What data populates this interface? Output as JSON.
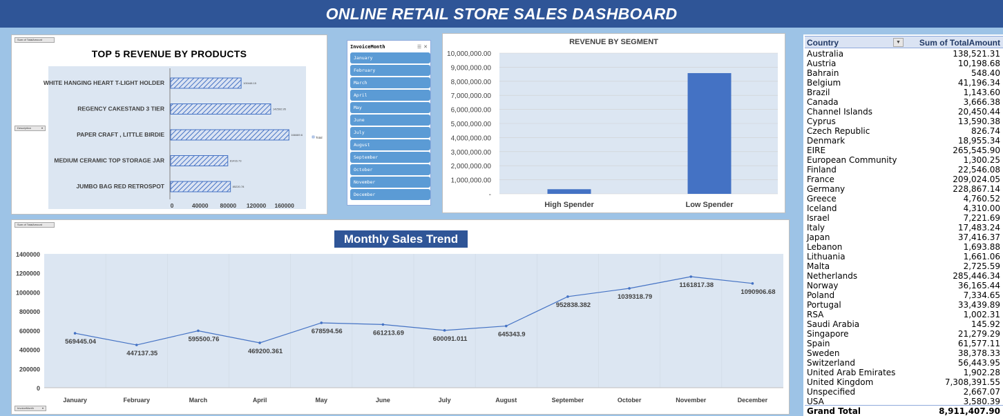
{
  "dashboard_title": "ONLINE RETAIL STORE SALES DASHBOARD",
  "pivot_buttons": {
    "sum_total_amount": "Sum of TotalAmount",
    "description": "Description",
    "invoice_month": "InvoiceMonth"
  },
  "slicer": {
    "title": "InvoiceMonth",
    "items": [
      "January",
      "February",
      "March",
      "April",
      "May",
      "June",
      "July",
      "August",
      "September",
      "October",
      "November",
      "December"
    ]
  },
  "pivot_table": {
    "col_country": "Country",
    "col_amount": "Sum of TotalAmount",
    "rows": [
      {
        "country": "Australia",
        "amount": "138,521.31"
      },
      {
        "country": "Austria",
        "amount": "10,198.68"
      },
      {
        "country": "Bahrain",
        "amount": "548.40"
      },
      {
        "country": "Belgium",
        "amount": "41,196.34"
      },
      {
        "country": "Brazil",
        "amount": "1,143.60"
      },
      {
        "country": "Canada",
        "amount": "3,666.38"
      },
      {
        "country": "Channel Islands",
        "amount": "20,450.44"
      },
      {
        "country": "Cyprus",
        "amount": "13,590.38"
      },
      {
        "country": "Czech Republic",
        "amount": "826.74"
      },
      {
        "country": "Denmark",
        "amount": "18,955.34"
      },
      {
        "country": "EIRE",
        "amount": "265,545.90"
      },
      {
        "country": "European Community",
        "amount": "1,300.25"
      },
      {
        "country": "Finland",
        "amount": "22,546.08"
      },
      {
        "country": "France",
        "amount": "209,024.05"
      },
      {
        "country": "Germany",
        "amount": "228,867.14"
      },
      {
        "country": "Greece",
        "amount": "4,760.52"
      },
      {
        "country": "Iceland",
        "amount": "4,310.00"
      },
      {
        "country": "Israel",
        "amount": "7,221.69"
      },
      {
        "country": "Italy",
        "amount": "17,483.24"
      },
      {
        "country": "Japan",
        "amount": "37,416.37"
      },
      {
        "country": "Lebanon",
        "amount": "1,693.88"
      },
      {
        "country": "Lithuania",
        "amount": "1,661.06"
      },
      {
        "country": "Malta",
        "amount": "2,725.59"
      },
      {
        "country": "Netherlands",
        "amount": "285,446.34"
      },
      {
        "country": "Norway",
        "amount": "36,165.44"
      },
      {
        "country": "Poland",
        "amount": "7,334.65"
      },
      {
        "country": "Portugal",
        "amount": "33,439.89"
      },
      {
        "country": "RSA",
        "amount": "1,002.31"
      },
      {
        "country": "Saudi Arabia",
        "amount": "145.92"
      },
      {
        "country": "Singapore",
        "amount": "21,279.29"
      },
      {
        "country": "Spain",
        "amount": "61,577.11"
      },
      {
        "country": "Sweden",
        "amount": "38,378.33"
      },
      {
        "country": "Switzerland",
        "amount": "56,443.95"
      },
      {
        "country": "United Arab Emirates",
        "amount": "1,902.28"
      },
      {
        "country": "United Kingdom",
        "amount": "7,308,391.55"
      },
      {
        "country": "Unspecified",
        "amount": "2,667.07"
      },
      {
        "country": "USA",
        "amount": "3,580.39"
      }
    ],
    "grand_total_label": "Grand Total",
    "grand_total_value": "8,911,407.90"
  },
  "chart_data": [
    {
      "type": "bar",
      "orientation": "horizontal",
      "title": "TOP 5 REVENUE BY PRODUCTS",
      "categories": [
        "WHITE HANGING HEART T-LIGHT HOLDER",
        "REGENCY CAKESTAND 3 TIER",
        "PAPER CRAFT , LITTLE BIRDIE",
        "MEDIUM CERAMIC TOP STORAGE JAR",
        "JUMBO BAG RED RETROSPOT"
      ],
      "series": [
        {
          "name": "Total",
          "values": [
            100448.15,
            142592.95,
            168469.6,
            81416.73,
            85220.78
          ]
        }
      ],
      "value_labels": [
        "100448.15",
        "142592.95",
        "168469.6",
        "81416.73",
        "85220.78"
      ],
      "xticks": [
        "0",
        "40000",
        "80000",
        "120000",
        "160000"
      ],
      "xlim": [
        0,
        180000
      ],
      "legend": "right",
      "bar_color": "#4472c4"
    },
    {
      "type": "bar",
      "title": "REVENUE BY SEGMENT",
      "categories": [
        "High Spender",
        "Low Spender"
      ],
      "values": [
        330000,
        8580000
      ],
      "yticks": [
        "10,000,000.00",
        "9,000,000.00",
        "8,000,000.00",
        "7,000,000.00",
        "6,000,000.00",
        "5,000,000.00",
        "4,000,000.00",
        "3,000,000.00",
        "2,000,000.00",
        "1,000,000.00",
        "-"
      ],
      "ylim": [
        0,
        10000000
      ],
      "bar_color": "#4472c4"
    },
    {
      "type": "line",
      "title": "Monthly Sales Trend",
      "categories": [
        "January",
        "February",
        "March",
        "April",
        "May",
        "June",
        "July",
        "August",
        "September",
        "October",
        "November",
        "December"
      ],
      "values": [
        569445.04,
        447137.35,
        595500.76,
        469200.361,
        678594.56,
        661213.69,
        600091.011,
        645343.9,
        952838.382,
        1039318.79,
        1161817.38,
        1090906.68
      ],
      "value_labels": [
        "569445.04",
        "447137.35",
        "595500.76",
        "469200.361",
        "678594.56",
        "661213.69",
        "600091.011",
        "645343.9",
        "952838.382",
        "1039318.79",
        "1161817.38",
        "1090906.68"
      ],
      "yticks": [
        "1400000",
        "1200000",
        "1000000",
        "800000",
        "600000",
        "400000",
        "200000",
        "0"
      ],
      "ylim": [
        0,
        1400000
      ],
      "line_color": "#4472c4"
    }
  ]
}
